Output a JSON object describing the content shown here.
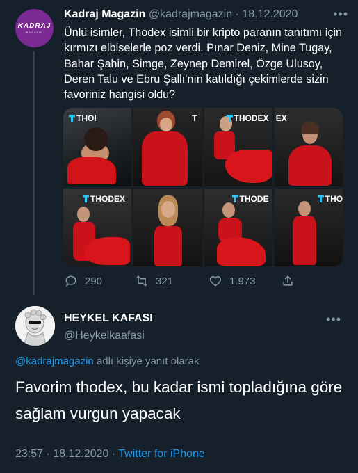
{
  "parent": {
    "avatar_logo": "KADRAJ",
    "avatar_logo_sub": "MAGAZIN",
    "name": "Kadraj Magazin",
    "handle": "@kadrajmagazin",
    "separator": "·",
    "date": "18.12.2020",
    "more": "•••",
    "text": "Ünlü isimler, Thodex isimli bir kripto paranın tanıtımı için kırmızı elbiselerle poz verdi. Pınar Deniz, Mine Tugay, Bahar Şahin, Simge, Zeynep Demirel, Özge Ulusoy, Deren Talu ve Ebru Şallı'nın katıldığı çekimlerde sizin favoriniz hangisi oldu?",
    "image_brands": [
      "THOI",
      "T",
      "THODEX",
      "EX",
      "THODEX",
      "",
      "THODE",
      "THOI"
    ],
    "replies": "290",
    "retweets": "321",
    "likes": "1.973"
  },
  "reply": {
    "name": "HEYKEL KAFASI",
    "handle": "@Heykelkaafasi",
    "more": "•••",
    "replying_handle": "@kadrajmagazin",
    "replying_suffix": " adlı kişiye yanıt olarak",
    "text": "Favorim thodex, bu kadar ismi topladığına göre sağlam vurgun yapacak",
    "time": "23:57",
    "separator": " · ",
    "date": "18.12.2020",
    "source": "Twitter for iPhone"
  },
  "colors": {
    "background": "#15202b",
    "muted": "#8899a6",
    "link": "#1d9bf0",
    "dress_red": "#d0141a"
  }
}
